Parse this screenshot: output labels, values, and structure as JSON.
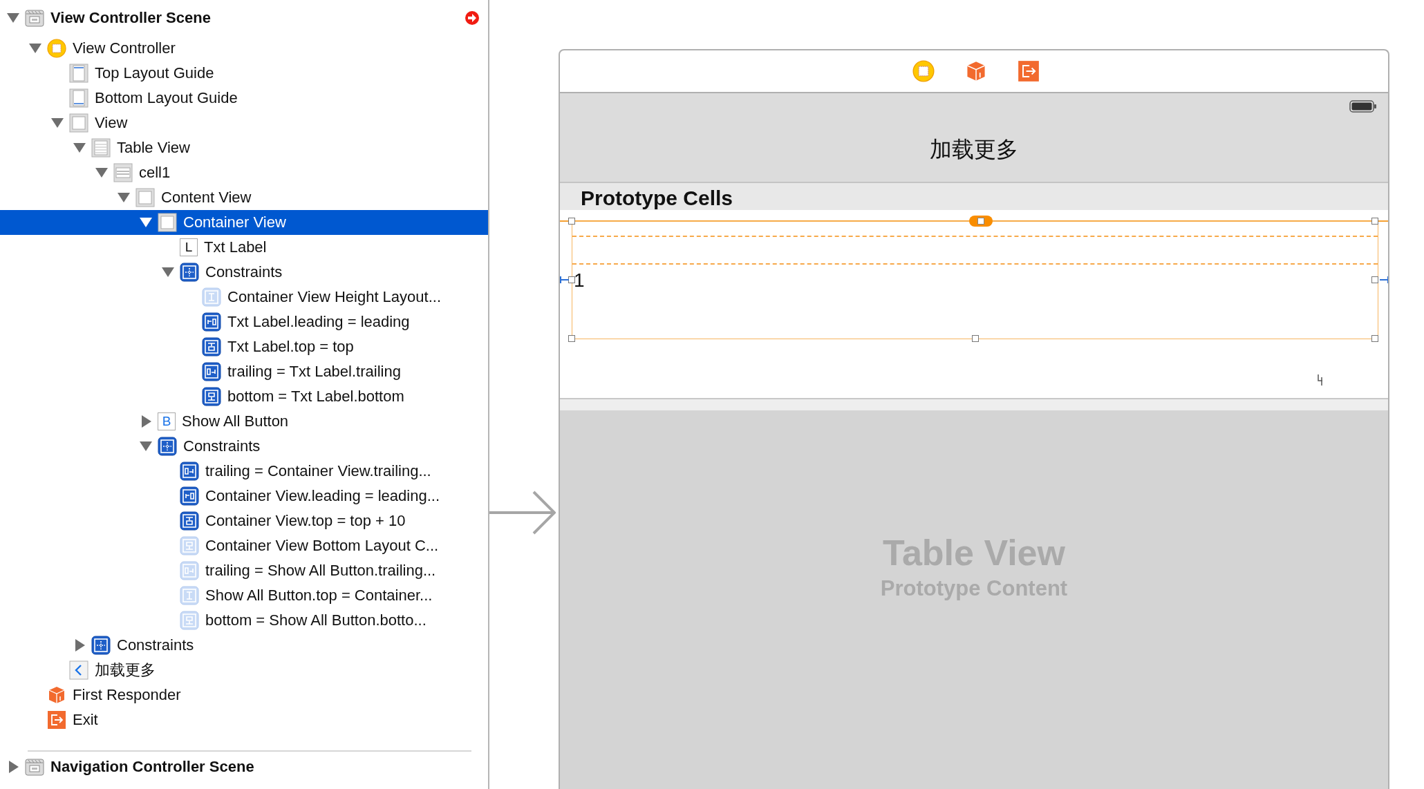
{
  "outline": {
    "scenes": [
      {
        "label": "View Controller Scene",
        "kind": "scene",
        "expanded": true,
        "issue": true,
        "selected": false,
        "children": [
          {
            "label": "View Controller",
            "kind": "viewcontroller",
            "expanded": true,
            "selected": false,
            "children": [
              {
                "label": "Top Layout Guide",
                "kind": "guide-top",
                "selected": false
              },
              {
                "label": "Bottom Layout Guide",
                "kind": "guide-bottom",
                "selected": false
              },
              {
                "label": "View",
                "kind": "view",
                "expanded": true,
                "selected": false,
                "children": [
                  {
                    "label": "Table View",
                    "kind": "tableview",
                    "expanded": true,
                    "selected": false,
                    "children": [
                      {
                        "label": "cell1",
                        "kind": "cell",
                        "expanded": true,
                        "selected": false,
                        "children": [
                          {
                            "label": "Content View",
                            "kind": "view",
                            "expanded": true,
                            "selected": false,
                            "children": [
                              {
                                "label": "Container View",
                                "kind": "view",
                                "expanded": true,
                                "selected": true,
                                "children": [
                                  {
                                    "label": "Txt Label",
                                    "kind": "label",
                                    "icon_glyph": "L",
                                    "selected": false
                                  },
                                  {
                                    "label": "Constraints",
                                    "kind": "constraints",
                                    "expanded": true,
                                    "selected": false,
                                    "children": [
                                      {
                                        "label": "Container View Height Layout...",
                                        "kind": "constraint-height",
                                        "faded": true,
                                        "selected": false
                                      },
                                      {
                                        "label": "Txt Label.leading = leading",
                                        "kind": "constraint-leading",
                                        "faded": false,
                                        "selected": false
                                      },
                                      {
                                        "label": "Txt Label.top = top",
                                        "kind": "constraint-top",
                                        "faded": false,
                                        "selected": false
                                      },
                                      {
                                        "label": "trailing = Txt Label.trailing",
                                        "kind": "constraint-trailing",
                                        "faded": false,
                                        "selected": false
                                      },
                                      {
                                        "label": "bottom = Txt Label.bottom",
                                        "kind": "constraint-bottom",
                                        "faded": false,
                                        "selected": false
                                      }
                                    ]
                                  }
                                ]
                              },
                              {
                                "label": "Show All Button",
                                "kind": "button",
                                "icon_glyph": "B",
                                "expanded": false,
                                "selected": false
                              },
                              {
                                "label": "Constraints",
                                "kind": "constraints",
                                "expanded": true,
                                "selected": false,
                                "children": [
                                  {
                                    "label": "trailing = Container View.trailing...",
                                    "kind": "constraint-trailing",
                                    "faded": false,
                                    "selected": false
                                  },
                                  {
                                    "label": "Container View.leading = leading...",
                                    "kind": "constraint-leading",
                                    "faded": false,
                                    "selected": false
                                  },
                                  {
                                    "label": "Container View.top = top + 10",
                                    "kind": "constraint-top",
                                    "faded": false,
                                    "selected": false
                                  },
                                  {
                                    "label": "Container View Bottom Layout C...",
                                    "kind": "constraint-bottom",
                                    "faded": true,
                                    "selected": false
                                  },
                                  {
                                    "label": "trailing = Show All Button.trailing...",
                                    "kind": "constraint-trailing",
                                    "faded": true,
                                    "selected": false
                                  },
                                  {
                                    "label": "Show All Button.top = Container...",
                                    "kind": "constraint-height",
                                    "faded": true,
                                    "selected": false
                                  },
                                  {
                                    "label": "bottom = Show All Button.botto...",
                                    "kind": "constraint-bottom",
                                    "faded": true,
                                    "selected": false
                                  }
                                ]
                              }
                            ]
                          }
                        ]
                      }
                    ]
                  },
                  {
                    "label": "Constraints",
                    "kind": "constraints",
                    "expanded": false,
                    "selected": false
                  }
                ]
              },
              {
                "label": "加载更多",
                "kind": "back",
                "selected": false
              }
            ]
          },
          {
            "label": "First Responder",
            "kind": "responder",
            "selected": false
          },
          {
            "label": "Exit",
            "kind": "exit",
            "selected": false
          }
        ]
      },
      {
        "label": "Navigation Controller Scene",
        "kind": "scene",
        "expanded": false,
        "issue": false,
        "selected": false
      }
    ]
  },
  "canvas": {
    "dock_icons": [
      {
        "kind": "viewcontroller"
      },
      {
        "kind": "responder"
      },
      {
        "kind": "exit"
      }
    ],
    "nav_title": "加载更多",
    "section_header": "Prototype Cells",
    "cell_label": "1",
    "placeholder_title": "Table View",
    "placeholder_subtitle": "Prototype Content"
  }
}
